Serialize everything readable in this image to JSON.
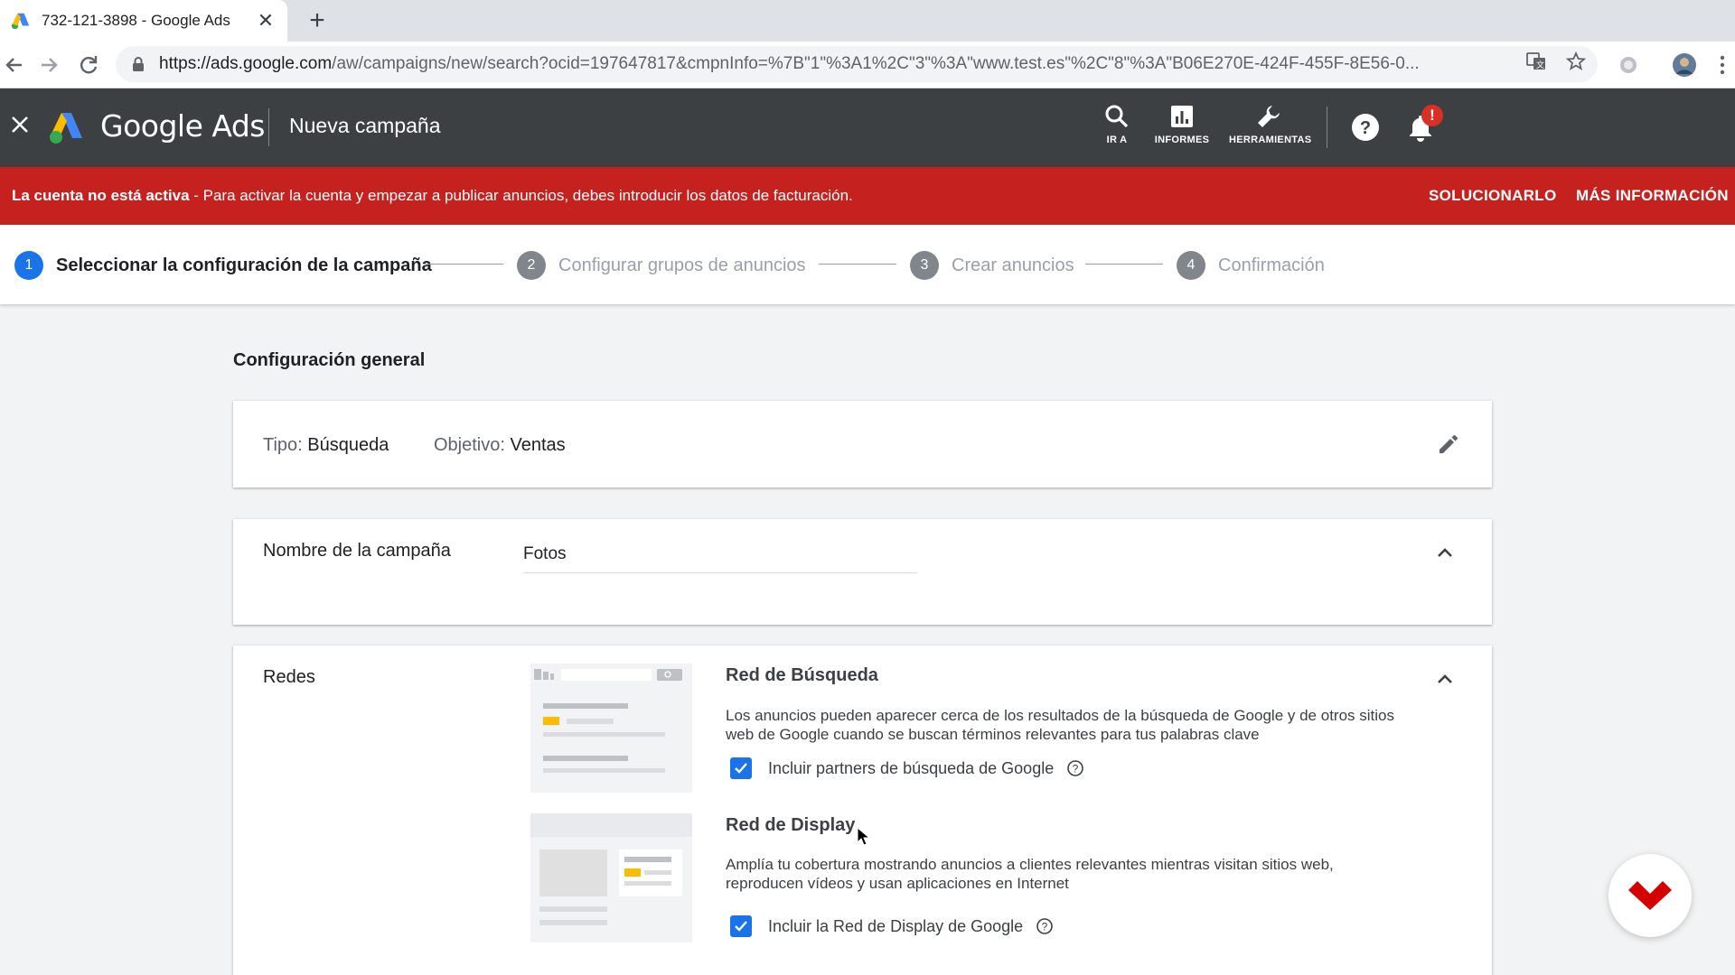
{
  "browser": {
    "tab_title": "732-121-3898 - Google Ads",
    "tab_close": "✕",
    "new_tab": "+",
    "url_host": "https://ads.google.com",
    "url_rest": "/aw/campaigns/new/search?ocid=197647817&cmpnInfo=%7B\"1\"%3A1%2C\"3\"%3A\"www.test.es\"%2C\"8\"%3A\"B06E270E-424F-455F-8E56-0..."
  },
  "header": {
    "brand": "Google Ads",
    "page_title": "Nueva campaña",
    "tools": [
      {
        "label": "IR A"
      },
      {
        "label": "INFORMES"
      },
      {
        "label": "HERRAMIENTAS"
      }
    ],
    "notification_badge": "!"
  },
  "alert": {
    "bold": "La cuenta no está activa",
    "text": " - Para activar la cuenta y empezar a publicar anuncios, debes introducir los datos de facturación.",
    "fix": "SOLUCIONARLO",
    "more": "MÁS INFORMACIÓN"
  },
  "stepper": {
    "steps": [
      {
        "num": "1",
        "label": "Seleccionar la configuración de la campaña"
      },
      {
        "num": "2",
        "label": "Configurar grupos de anuncios"
      },
      {
        "num": "3",
        "label": "Crear anuncios"
      },
      {
        "num": "4",
        "label": "Confirmación"
      }
    ]
  },
  "general": {
    "title": "Configuración general",
    "type_label": "Tipo: ",
    "type_value": "Búsqueda",
    "goal_label": "Objetivo: ",
    "goal_value": "Ventas"
  },
  "campaign_name": {
    "label": "Nombre de la campaña",
    "value": "Fotos"
  },
  "networks": {
    "label": "Redes",
    "search": {
      "title": "Red de Búsqueda",
      "desc": "Los anuncios pueden aparecer cerca de los resultados de la búsqueda de Google y de otros sitios web de Google cuando se buscan términos relevantes para tus palabras clave",
      "checkbox": "Incluir partners de búsqueda de Google"
    },
    "display": {
      "title": "Red de Display",
      "desc": "Amplía tu cobertura mostrando anuncios a clientes relevantes mientras visitan sitios web, reproducen vídeos y usan aplicaciones en Internet",
      "checkbox": "Incluir la Red de Display de Google"
    }
  },
  "colors": {
    "primary": "#1a73e8",
    "alert": "#c5221f",
    "header": "#3c4043"
  }
}
